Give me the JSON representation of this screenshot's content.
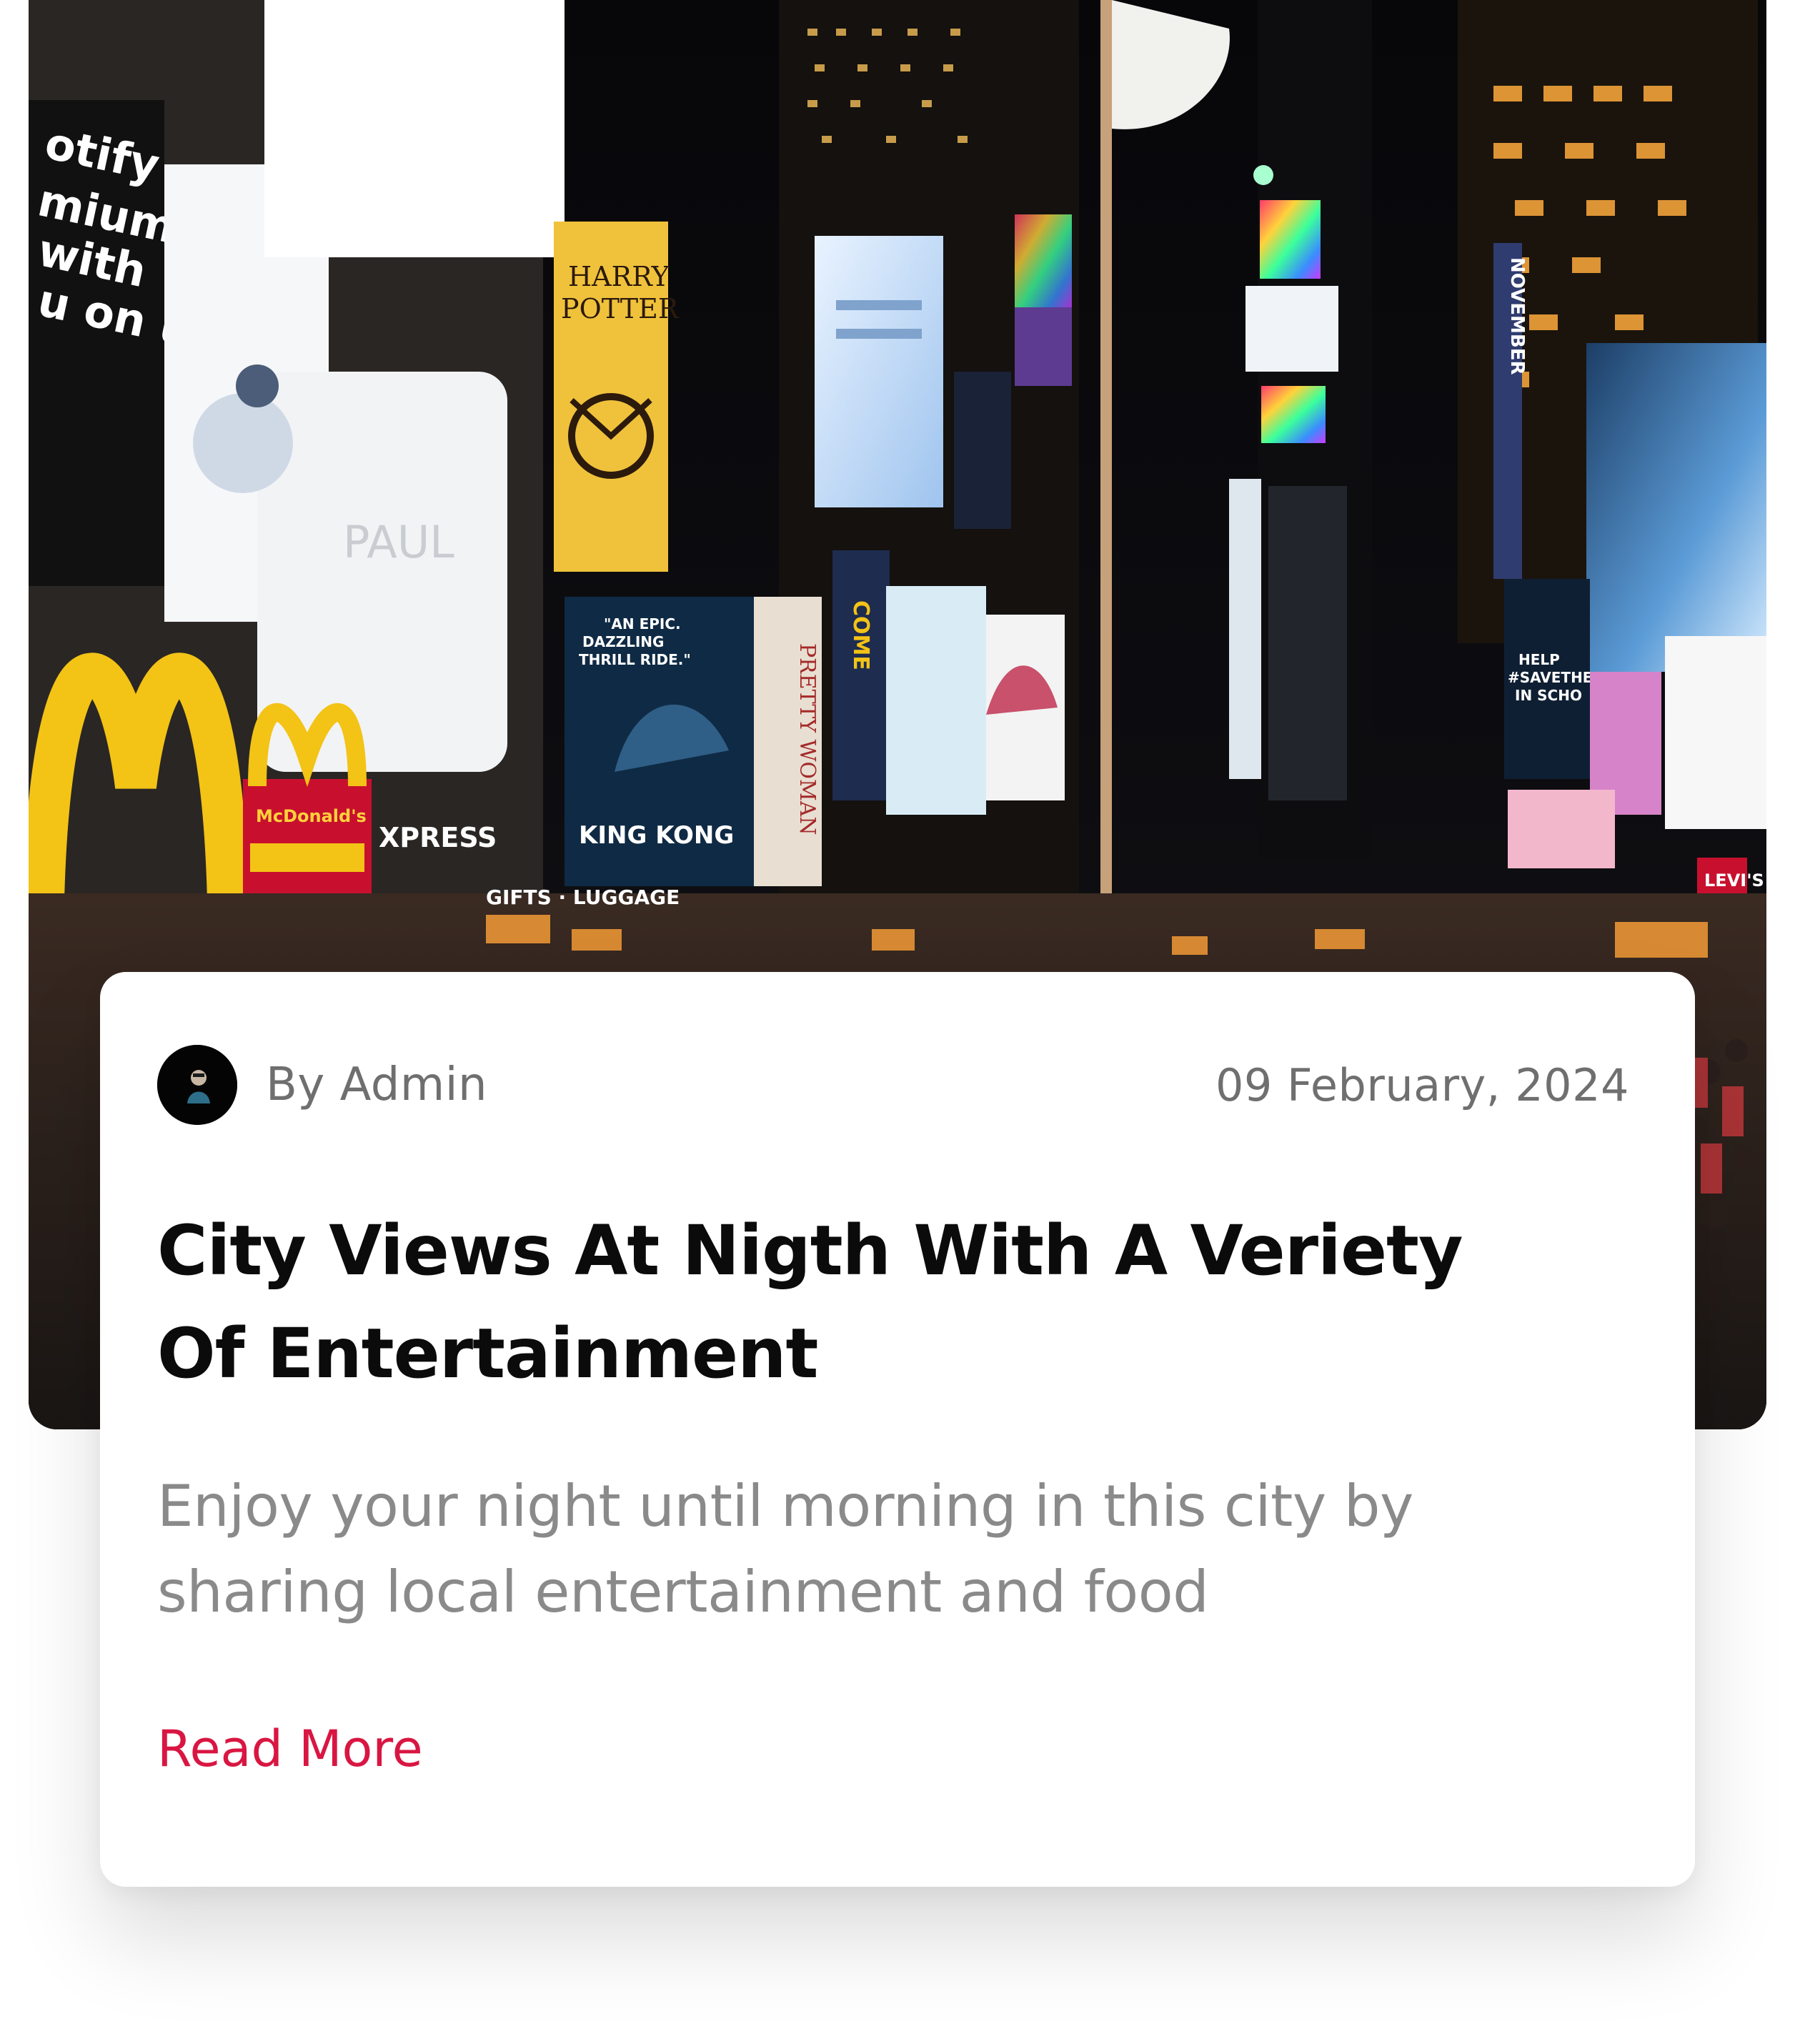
{
  "post": {
    "image": {
      "alt": "Times Square at night with illuminated billboards",
      "billboard_texts": [
        "otify",
        "mium,",
        "with",
        "u on us.",
        "HARRY POTTER",
        "\"AN EPIC. DAZZLING THRILL RIDE.\"",
        "KING KONG",
        "McDonald's",
        "XPRESS",
        "GIFTS · LUGGAGE",
        "LEVI'S",
        "HELP #SAVETHE IN SCHO"
      ]
    },
    "author": "By Admin",
    "date": "09 February, 2024",
    "title": "City Views At Nigth With A Veriety Of Entertainment",
    "excerpt": "Enjoy your night until morning in this city by sharing local entertainment and food",
    "read_more_label": "Read More",
    "colors": {
      "accent": "#d91642",
      "title": "#0b0b0b",
      "meta_text": "#6f6f6f",
      "excerpt_text": "#8a8a8a"
    }
  }
}
